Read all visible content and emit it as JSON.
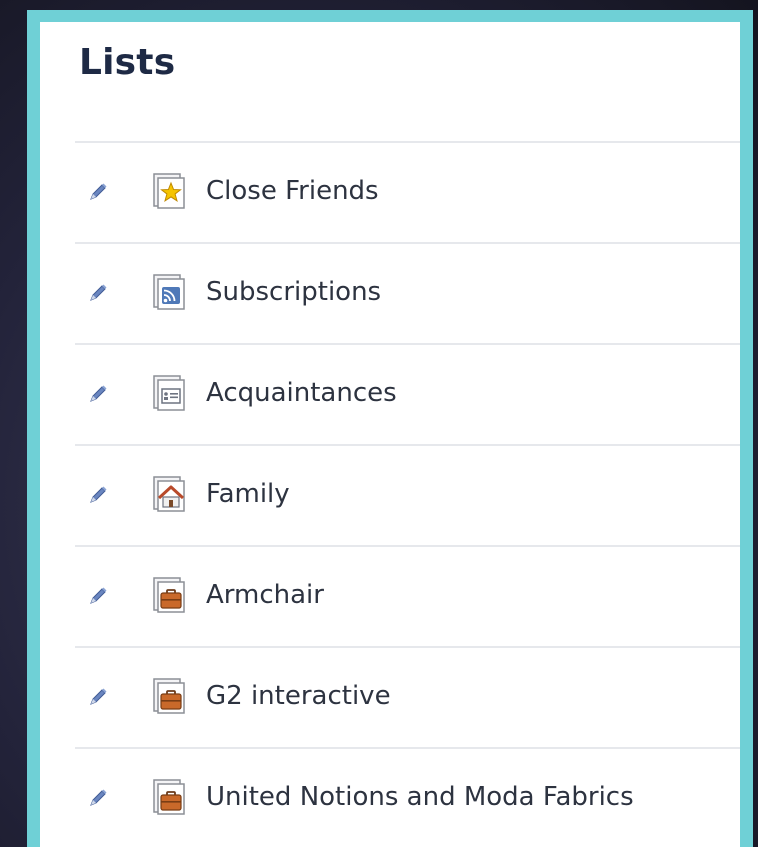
{
  "panel": {
    "title": "Lists",
    "frame_color": "#6fd0d6"
  },
  "lists": [
    {
      "label": "Close Friends",
      "icon": "star-list-icon"
    },
    {
      "label": "Subscriptions",
      "icon": "rss-list-icon"
    },
    {
      "label": "Acquaintances",
      "icon": "contact-card-list-icon"
    },
    {
      "label": "Family",
      "icon": "house-list-icon"
    },
    {
      "label": "Armchair",
      "icon": "briefcase-list-icon"
    },
    {
      "label": "G2 interactive",
      "icon": "briefcase-list-icon"
    },
    {
      "label": "United Notions and Moda Fabrics",
      "icon": "briefcase-list-icon"
    }
  ],
  "edit_icon": "pencil-icon"
}
